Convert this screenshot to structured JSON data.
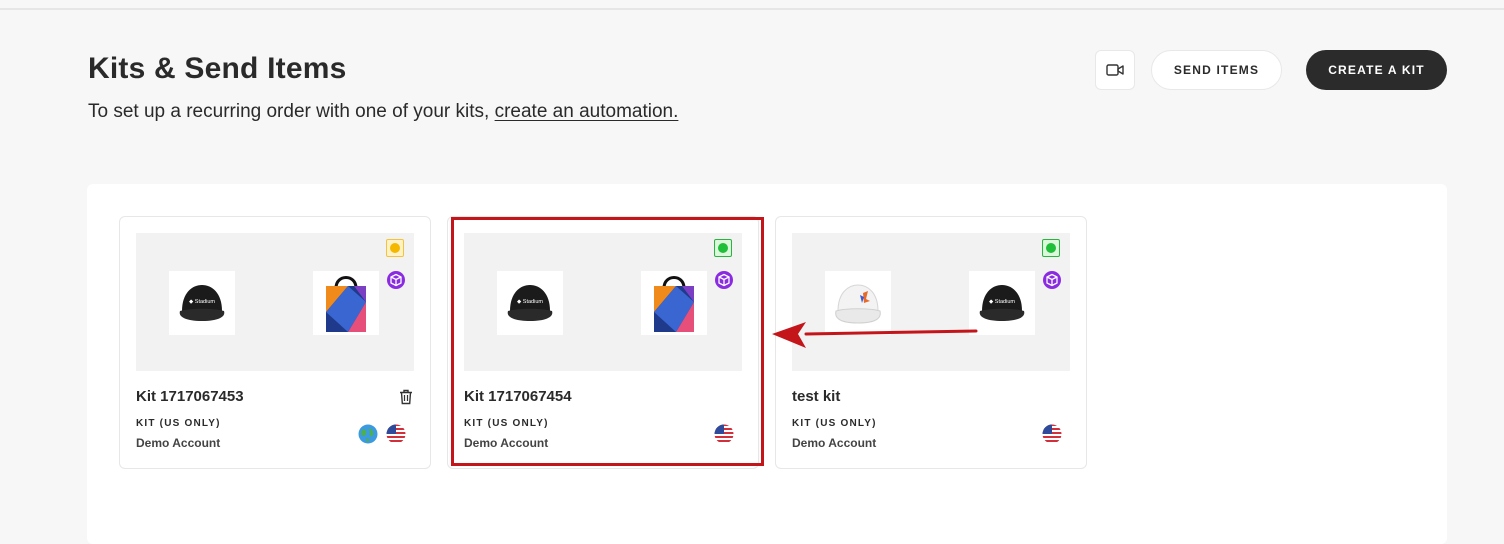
{
  "header": {
    "title": "Kits & Send Items",
    "subtitle_prefix": "To set up a recurring order with one of your kits, ",
    "subtitle_link": "create an automation."
  },
  "actions": {
    "video_icon": "video-camera-icon",
    "send_items_label": "SEND ITEMS",
    "create_kit_label": "CREATE A KIT"
  },
  "colors": {
    "accent_dark": "#2b2b2b",
    "status_yellow": "#f5b800",
    "status_green": "#1fbf3a",
    "box_purple": "#8a2be2",
    "highlight_red": "#c4151a"
  },
  "kits": [
    {
      "title": "Kit 1717067453",
      "type": "KIT (US ONLY)",
      "account": "Demo Account",
      "status": "yellow",
      "products": [
        "black-stadium-cap",
        "tote-bag"
      ],
      "flags": [
        "globe-icon",
        "us-flag-icon"
      ],
      "has_delete": true
    },
    {
      "title": "Kit 1717067454",
      "type": "KIT (US ONLY)",
      "account": "Demo Account",
      "status": "green",
      "products": [
        "black-stadium-cap",
        "tote-bag"
      ],
      "flags": [
        "us-flag-icon"
      ],
      "has_delete": false
    },
    {
      "title": "test kit",
      "type": "KIT (US ONLY)",
      "account": "Demo Account",
      "status": "green",
      "products": [
        "white-cap",
        "black-stadium-cap"
      ],
      "flags": [
        "us-flag-icon"
      ],
      "has_delete": false
    }
  ]
}
